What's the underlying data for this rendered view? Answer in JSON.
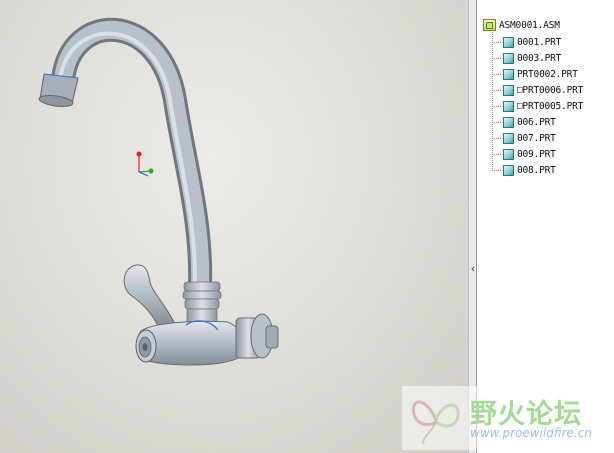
{
  "model_tree": {
    "root": "ASM0001.ASM",
    "items": [
      {
        "label": "0001.PRT",
        "icon": "part-icon",
        "flag": ""
      },
      {
        "label": "0003.PRT",
        "icon": "part-icon",
        "flag": ""
      },
      {
        "label": "PRT0002.PRT",
        "icon": "part-icon",
        "flag": ""
      },
      {
        "label": "PRT0006.PRT",
        "icon": "part-icon",
        "flag": "□"
      },
      {
        "label": "PRT0005.PRT",
        "icon": "part-icon",
        "flag": "□"
      },
      {
        "label": "006.PRT",
        "icon": "part-icon",
        "flag": ""
      },
      {
        "label": "007.PRT",
        "icon": "part-icon",
        "flag": ""
      },
      {
        "label": "009.PRT",
        "icon": "part-icon",
        "flag": ""
      },
      {
        "label": "008.PRT",
        "icon": "part-icon",
        "flag": ""
      }
    ]
  },
  "sash": {
    "arrow": "‹"
  },
  "watermark": {
    "title": "野火论坛",
    "url": "www.proewildfire.cn",
    "color": "#9bd889"
  },
  "colors": {
    "viewport_bg": "#e0dfd9",
    "model_metal": "#a9b0bb",
    "tree_bg": "#ffffff",
    "axis_x": "#e02020",
    "axis_y": "#20b020"
  }
}
